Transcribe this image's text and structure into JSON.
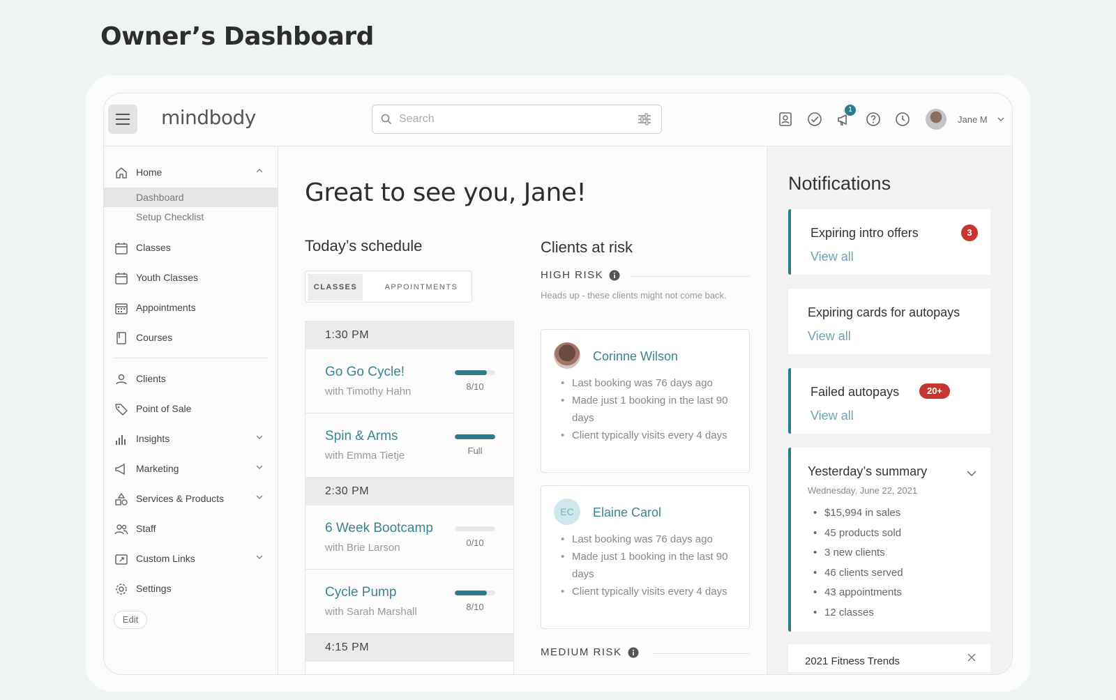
{
  "page": {
    "heading": "Owner’s Dashboard"
  },
  "topbar": {
    "brand": "mindbody",
    "search_placeholder": "Search",
    "notification_count": "1",
    "user_name": "Jane M",
    "icons": [
      "contacts-icon",
      "check-circle-icon",
      "megaphone-icon",
      "help-icon",
      "clock-icon"
    ]
  },
  "sidebar": {
    "home": "Home",
    "sub": [
      "Dashboard",
      "Setup Checklist"
    ],
    "items": [
      {
        "label": "Classes"
      },
      {
        "label": "Youth Classes"
      },
      {
        "label": "Appointments"
      },
      {
        "label": "Courses"
      },
      {
        "label": "Clients"
      },
      {
        "label": "Point of Sale"
      },
      {
        "label": "Insights"
      },
      {
        "label": "Marketing"
      },
      {
        "label": "Services & Products"
      },
      {
        "label": "Staff"
      },
      {
        "label": "Custom Links"
      },
      {
        "label": "Settings"
      }
    ],
    "edit": "Edit"
  },
  "main": {
    "greeting": "Great to see you, Jane!",
    "schedule_title": "Today’s schedule",
    "tabs": [
      "CLASSES",
      "APPOINTMENTS"
    ],
    "times": [
      "1:30 PM",
      "2:30 PM",
      "4:15 PM"
    ],
    "classes": [
      {
        "name": "Go Go Cycle!",
        "with": "with Timothy Hahn",
        "cap": "8/10",
        "fill": 0.8
      },
      {
        "name": "Spin & Arms",
        "with": "with Emma Tietje",
        "cap": "Full",
        "fill": 1.0
      },
      {
        "name": "6 Week Bootcamp",
        "with": "with Brie Larson",
        "cap": "0/10",
        "fill": 0
      },
      {
        "name": "Cycle Pump",
        "with": "with Sarah Marshall",
        "cap": "8/10",
        "fill": 0.8
      }
    ],
    "risk_title": "Clients at risk",
    "high_risk": "HIGH RISK",
    "high_note": "Heads up - these clients might not come back.",
    "medium_risk": "MEDIUM RISK",
    "clients": [
      {
        "name": "Corinne Wilson",
        "initials": "",
        "bullets": [
          "Last booking was 76 days ago",
          "Made just 1 booking in the last 90 days",
          "Client typically visits every 4 days"
        ]
      },
      {
        "name": "Elaine Carol",
        "initials": "EC",
        "bullets": [
          "Last booking was 76 days ago",
          "Made just 1 booking in the last 90 days",
          "Client typically visits every 4 days"
        ]
      }
    ]
  },
  "notifications": {
    "title": "Notifications",
    "cards": [
      {
        "title": "Expiring intro offers",
        "link": "View all",
        "badge": "3"
      },
      {
        "title": "Expiring cards for autopays",
        "link": "View all",
        "badge": ""
      },
      {
        "title": "Failed autopays",
        "link": "View all",
        "badge": "20+"
      }
    ],
    "summary": {
      "title": "Yesterday’s summary",
      "date": "Wednesday, June 22, 2021",
      "items": [
        "$15,994 in sales",
        "45 products sold",
        "3 new clients",
        "46 clients served",
        "43 appointments",
        "12 classes"
      ]
    },
    "peek_title": "2021 Fitness Trends"
  },
  "colors": {
    "accent": "#2b7c8c",
    "link": "#3a8492",
    "alert": "#c6362e"
  }
}
